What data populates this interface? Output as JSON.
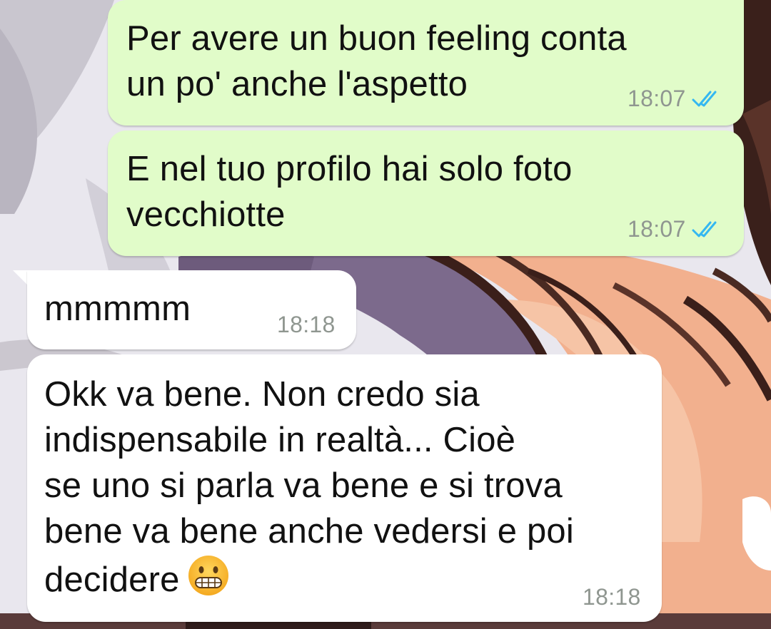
{
  "chat": {
    "messages": [
      {
        "direction": "outgoing",
        "text": "Per avere un buon feeling conta\nun po' anche l'aspetto",
        "time": "18:07",
        "status_icon": "double-check-read-icon"
      },
      {
        "direction": "outgoing",
        "text": "E nel tuo profilo hai solo foto\nvecchiotte",
        "time": "18:07",
        "status_icon": "double-check-read-icon"
      },
      {
        "direction": "incoming",
        "text": "mmmmm",
        "time": "18:18"
      },
      {
        "direction": "incoming",
        "text": "Okk va bene. Non credo sia\nindispensabile in realtà... Cioè\nse uno si parla va bene e si trova\nbene va bene anche vedersi e poi\ndecidere",
        "emoji": "grimacing-face-emoji",
        "time": "18:18"
      }
    ]
  },
  "colors": {
    "outgoing_bubble": "#e1fcc9",
    "incoming_bubble": "#ffffff",
    "read_ticks": "#34b7f1",
    "timestamp": "#8f9690"
  }
}
